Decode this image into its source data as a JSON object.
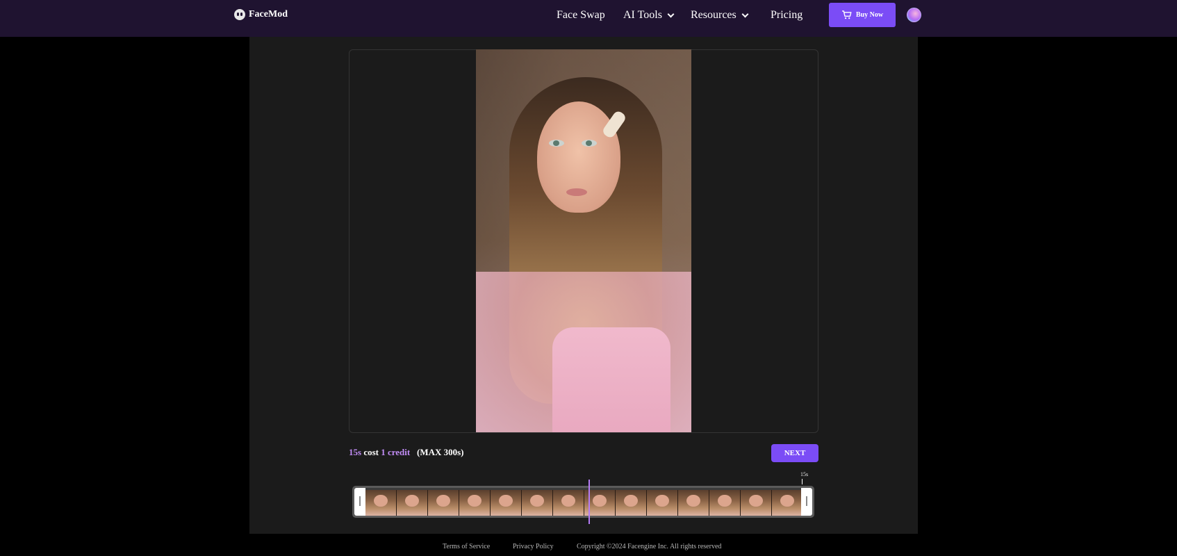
{
  "header": {
    "brand": "FaceMod",
    "nav": [
      {
        "label": "Face Swap"
      },
      {
        "label": "AI Tools"
      },
      {
        "label": "Resources"
      },
      {
        "label": "Pricing"
      }
    ],
    "buy_label": "Buy Now"
  },
  "editor": {
    "cost": {
      "duration": "15s",
      "cost_word": "cost",
      "credit": "1 credit",
      "max": "(MAX 300s)"
    },
    "next_label": "NEXT",
    "time_label": "15s",
    "frame_count": 14
  },
  "footer": {
    "terms": "Terms of Service",
    "privacy": "Privacy Policy",
    "copyright": "Copyright ©2024  Facengine Inc. All rights reserved"
  },
  "colors": {
    "accent": "#7b4cf6",
    "header_bg": "#1f1330",
    "panel_bg": "#1b1b1b",
    "highlight_text": "#c18cf5"
  }
}
